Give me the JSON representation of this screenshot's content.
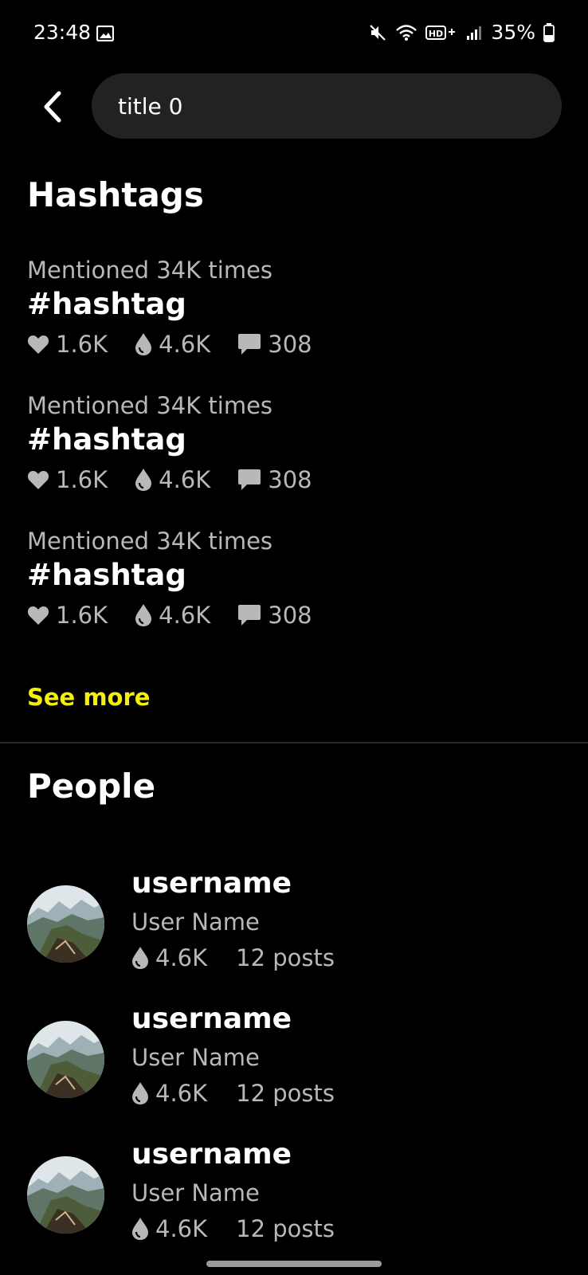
{
  "status_bar": {
    "time": "23:48",
    "battery_percent": "35%",
    "icons": [
      "gallery-icon",
      "mute-icon",
      "wifi-icon",
      "hd-plus-icon",
      "signal-icon",
      "battery-icon"
    ]
  },
  "search": {
    "value": "title 0"
  },
  "hashtags": {
    "title": "Hashtags",
    "items": [
      {
        "mention": "Mentioned 34K times",
        "tag": "#hashtag",
        "likes": "1.6K",
        "drops": "4.6K",
        "comments": "308"
      },
      {
        "mention": "Mentioned 34K times",
        "tag": "#hashtag",
        "likes": "1.6K",
        "drops": "4.6K",
        "comments": "308"
      },
      {
        "mention": "Mentioned 34K times",
        "tag": "#hashtag",
        "likes": "1.6K",
        "drops": "4.6K",
        "comments": "308"
      }
    ],
    "see_more": "See more"
  },
  "people": {
    "title": "People",
    "items": [
      {
        "username": "username",
        "name": "User Name",
        "drops": "4.6K",
        "posts": "12 posts"
      },
      {
        "username": "username",
        "name": "User Name",
        "drops": "4.6K",
        "posts": "12 posts"
      },
      {
        "username": "username",
        "name": "User Name",
        "drops": "4.6K",
        "posts": "12 posts"
      }
    ]
  },
  "colors": {
    "background": "#000000",
    "search_bg": "#222222",
    "accent": "#f4f007",
    "muted_text": "#b8b8b8"
  }
}
